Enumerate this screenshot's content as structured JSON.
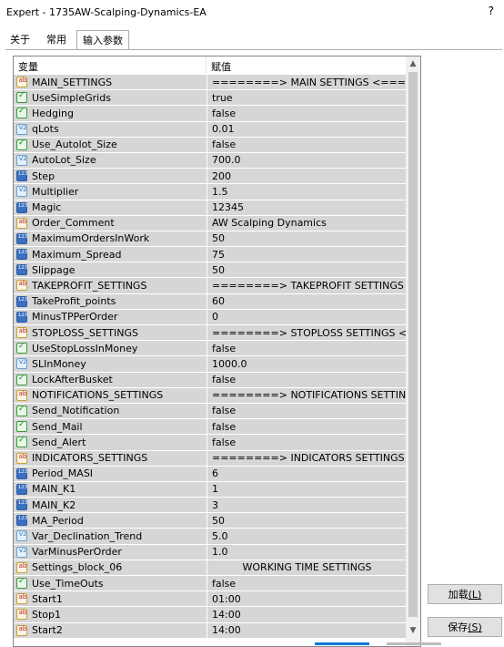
{
  "window": {
    "title": "Expert - 1735AW-Scalping-Dynamics-EA",
    "help_label": "?"
  },
  "tabs": [
    {
      "label": "关于",
      "active": false
    },
    {
      "label": "常用",
      "active": false
    },
    {
      "label": "输入参数",
      "active": true
    }
  ],
  "grid": {
    "col_variable": "变量",
    "col_value": "赋值",
    "rows": [
      {
        "type": "ab",
        "name": "MAIN_SETTINGS",
        "value": "========> MAIN SETTINGS  <====..."
      },
      {
        "type": "bool",
        "name": "UseSimpleGrids",
        "value": "true"
      },
      {
        "type": "bool",
        "name": "Hedging",
        "value": "false"
      },
      {
        "type": "dbl",
        "name": "qLots",
        "value": "0.01"
      },
      {
        "type": "bool",
        "name": "Use_Autolot_Size",
        "value": "false"
      },
      {
        "type": "dbl",
        "name": "AutoLot_Size",
        "value": "700.0"
      },
      {
        "type": "int",
        "name": "Step",
        "value": "200"
      },
      {
        "type": "dbl",
        "name": "Multiplier",
        "value": "1.5"
      },
      {
        "type": "int",
        "name": "Magic",
        "value": "12345"
      },
      {
        "type": "ab",
        "name": "Order_Comment",
        "value": "AW Scalping Dynamics"
      },
      {
        "type": "int",
        "name": "MaximumOrdersInWork",
        "value": "50"
      },
      {
        "type": "int",
        "name": "Maximum_Spread",
        "value": "75"
      },
      {
        "type": "int",
        "name": "Slippage",
        "value": "50"
      },
      {
        "type": "ab",
        "name": "TAKEPROFIT_SETTINGS",
        "value": "========> TAKEPROFIT SETTINGS  <..."
      },
      {
        "type": "int",
        "name": "TakeProfit_points",
        "value": "60"
      },
      {
        "type": "int",
        "name": "MinusTPPerOrder",
        "value": "0"
      },
      {
        "type": "ab",
        "name": "STOPLOSS_SETTINGS",
        "value": "========> STOPLOSS SETTINGS  <=..."
      },
      {
        "type": "bool",
        "name": "UseStopLossInMoney",
        "value": "false"
      },
      {
        "type": "dbl",
        "name": "SLInMoney",
        "value": "1000.0"
      },
      {
        "type": "bool",
        "name": "LockAfterBusket",
        "value": "false"
      },
      {
        "type": "ab",
        "name": "NOTIFICATIONS_SETTINGS",
        "value": "========> NOTIFICATIONS SETTINGS..."
      },
      {
        "type": "bool",
        "name": "Send_Notification",
        "value": "false"
      },
      {
        "type": "bool",
        "name": "Send_Mail",
        "value": "false"
      },
      {
        "type": "bool",
        "name": "Send_Alert",
        "value": "false"
      },
      {
        "type": "ab",
        "name": "INDICATORS_SETTINGS",
        "value": "========> INDICATORS SETTINGS  <..."
      },
      {
        "type": "int",
        "name": "Period_MASI",
        "value": "6"
      },
      {
        "type": "int",
        "name": "MAIN_K1",
        "value": "1"
      },
      {
        "type": "int",
        "name": "MAIN_K2",
        "value": "3"
      },
      {
        "type": "int",
        "name": "MA_Period",
        "value": "50"
      },
      {
        "type": "dbl",
        "name": "Var_Declination_Trend",
        "value": "5.0"
      },
      {
        "type": "dbl",
        "name": "VarMinusPerOrder",
        "value": "1.0"
      },
      {
        "type": "ab",
        "name": "Settings_block_06",
        "value": "WORKING TIME SETTINGS",
        "center": true
      },
      {
        "type": "bool",
        "name": "Use_TimeOuts",
        "value": "false"
      },
      {
        "type": "ab",
        "name": "Start1",
        "value": "01:00"
      },
      {
        "type": "ab",
        "name": "Stop1",
        "value": "14:00"
      },
      {
        "type": "ab",
        "name": "Start2",
        "value": "14:00"
      }
    ]
  },
  "buttons": {
    "load_label": "加载",
    "load_key": "(L)",
    "save_label": "保存",
    "save_key": "(S)"
  },
  "colors": {
    "accent": "#0078d7",
    "row_bg": "#d6d6d6"
  }
}
